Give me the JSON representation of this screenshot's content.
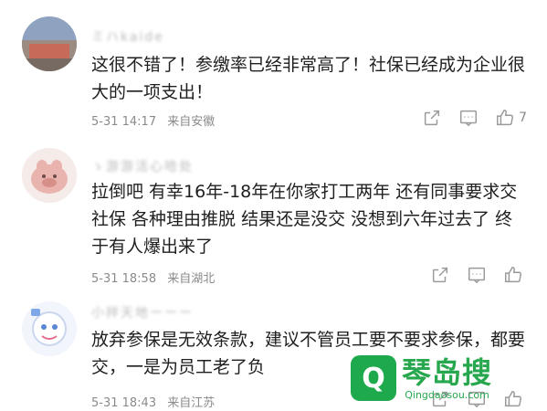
{
  "comments": [
    {
      "username": "ミハkaide",
      "text": "这很不错了！参缴率已经非常高了！社保已经成为企业很大的一项支出！",
      "time": "5-31 14:17",
      "location": "来自安徽",
      "likes": "7"
    },
    {
      "username": "ゝ游游活心哈处",
      "text": "拉倒吧 有幸16年-18年在你家打工两年 还有同事要求交社保 各种理由推脱 结果还是没交 没想到六年过去了 终于有人爆出来了",
      "time": "5-31 18:58",
      "location": "来自湖北",
      "likes": ""
    },
    {
      "username": "小拌天地ーーー",
      "text": "放弃参保是无效条款，建议不管员工要不要求参保，都要交，一是为员工老了负",
      "time": "5-31 18:43",
      "location": "来自江苏",
      "likes": ""
    }
  ],
  "watermark": {
    "brand": "琴岛搜",
    "url": "Qingdaosou.com"
  },
  "icons": [
    "share-icon",
    "comment-icon",
    "like-icon"
  ],
  "colors": {
    "watermark_green": "#27a84e",
    "meta_gray": "#8a8a8a"
  }
}
